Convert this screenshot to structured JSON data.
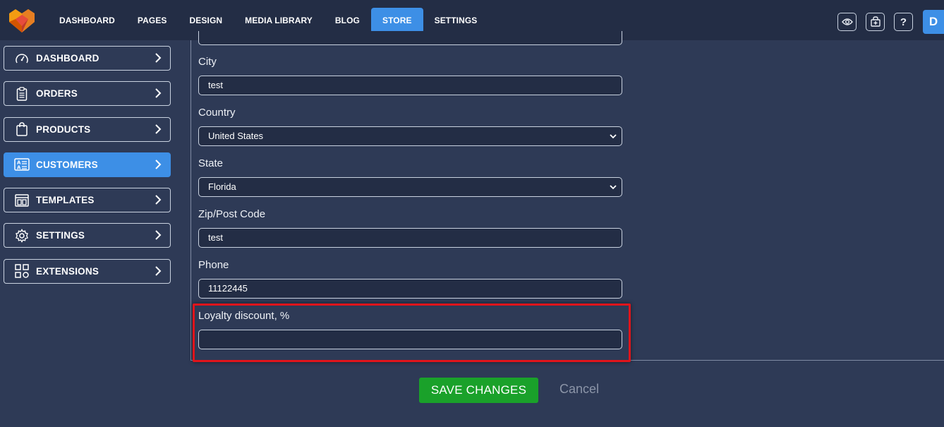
{
  "topnav": {
    "items": [
      {
        "label": "DASHBOARD",
        "active": false
      },
      {
        "label": "PAGES",
        "active": false
      },
      {
        "label": "DESIGN",
        "active": false
      },
      {
        "label": "MEDIA LIBRARY",
        "active": false
      },
      {
        "label": "BLOG",
        "active": false
      },
      {
        "label": "STORE",
        "active": true
      },
      {
        "label": "SETTINGS",
        "active": false
      }
    ],
    "icons": [
      "eye-icon",
      "store-add-icon",
      "help-icon"
    ],
    "help_glyph": "?",
    "avatar_letter": "D"
  },
  "sidebar": {
    "items": [
      {
        "label": "DASHBOARD",
        "icon": "gauge-icon",
        "active": false
      },
      {
        "label": "ORDERS",
        "icon": "clipboard-icon",
        "active": false
      },
      {
        "label": "PRODUCTS",
        "icon": "shopping-bag-icon",
        "active": false
      },
      {
        "label": "CUSTOMERS",
        "icon": "id-card-icon",
        "active": true
      },
      {
        "label": "TEMPLATES",
        "icon": "layout-icon",
        "active": false
      },
      {
        "label": "SETTINGS",
        "icon": "gear-icon",
        "active": false
      },
      {
        "label": "EXTENSIONS",
        "icon": "grid-icon",
        "active": false
      }
    ]
  },
  "form": {
    "city": {
      "label": "City",
      "value": "test"
    },
    "country": {
      "label": "Country",
      "value": "United States"
    },
    "state": {
      "label": "State",
      "value": "Florida"
    },
    "zip": {
      "label": "Zip/Post Code",
      "value": "test"
    },
    "phone": {
      "label": "Phone",
      "value": "11122445"
    },
    "loyalty": {
      "label": "Loyalty discount, %",
      "value": ""
    }
  },
  "actions": {
    "save_label": "SAVE CHANGES",
    "cancel_label": "Cancel"
  },
  "colors": {
    "background": "#2e3a56",
    "topbar": "#232d45",
    "accent": "#3d8fe6",
    "save": "#1aa12a",
    "highlight": "#e0141b"
  }
}
